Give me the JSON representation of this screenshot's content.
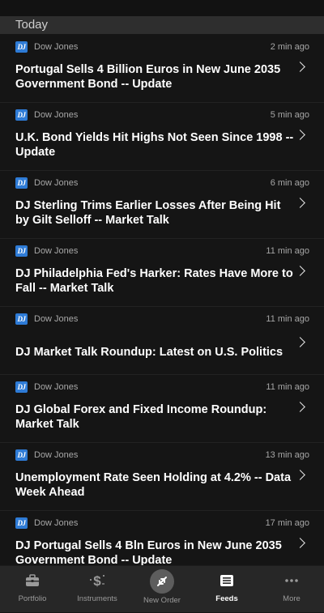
{
  "section": {
    "title": "Today"
  },
  "news": [
    {
      "source": "Dow Jones",
      "logo_text": "DJ",
      "time": "2 min ago",
      "headline": "Portugal Sells 4 Billion Euros in New June 2035 Government Bond -- Update"
    },
    {
      "source": "Dow Jones",
      "logo_text": "DJ",
      "time": "5 min ago",
      "headline": "U.K. Bond Yields Hit Highs Not Seen Since 1998 -- Update"
    },
    {
      "source": "Dow Jones",
      "logo_text": "DJ",
      "time": "6 min ago",
      "headline": "DJ  Sterling Trims Earlier Losses After Being Hit by Gilt Selloff -- Market Talk"
    },
    {
      "source": "Dow Jones",
      "logo_text": "DJ",
      "time": "11 min ago",
      "headline": "DJ  Philadelphia Fed's Harker: Rates Have More to Fall -- Market Talk"
    },
    {
      "source": "Dow Jones",
      "logo_text": "DJ",
      "time": "11 min ago",
      "headline": "DJ  Market Talk Roundup: Latest on U.S. Politics"
    },
    {
      "source": "Dow Jones",
      "logo_text": "DJ",
      "time": "11 min ago",
      "headline": "DJ  Global Forex and Fixed Income Roundup: Market Talk"
    },
    {
      "source": "Dow Jones",
      "logo_text": "DJ",
      "time": "13 min ago",
      "headline": "Unemployment Rate Seen Holding at 4.2% -- Data Week Ahead"
    },
    {
      "source": "Dow Jones",
      "logo_text": "DJ",
      "time": "17 min ago",
      "headline": "DJ  Portugal Sells 4 Bln Euros in New June 2035 Government Bond -- Update"
    }
  ],
  "tabbar": {
    "portfolio": "Portfolio",
    "instruments": "Instruments",
    "new_order": "New Order",
    "feeds": "Feeds",
    "more": "More"
  },
  "colors": {
    "background": "#151515",
    "section_header": "#2e2e2e",
    "tabbar": "#272727",
    "dj_logo": "#2e7bd6",
    "active_tab": "#ffffff",
    "inactive_tab": "#9a9a9a"
  },
  "icons": {
    "portfolio": "briefcase-icon",
    "instruments": "dollar-sparkle-icon",
    "new_order": "up-down-arrows-icon",
    "feeds": "news-icon",
    "more": "ellipsis-icon",
    "row": "chevron-right-icon"
  }
}
